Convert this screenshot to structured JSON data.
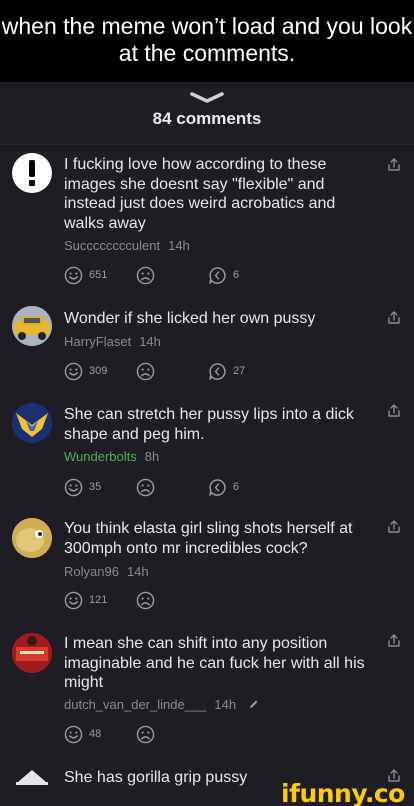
{
  "caption": "when the meme won’t load and you look at the comments.",
  "header": {
    "count_label": "84 comments"
  },
  "comments": [
    {
      "text": "I fucking love how according to these images she doesnt say \"flexible\" and instead just does weird acrobatics and walks away",
      "user": "Succcccccculent",
      "time": "14h",
      "smiles": "651",
      "replies": "6"
    },
    {
      "text": "Wonder if she licked her own pussy",
      "user": "HarryFlaset",
      "time": "14h",
      "smiles": "309",
      "replies": "27"
    },
    {
      "text": "She can stretch her pussy lips into a dick shape and peg him.",
      "user": "Wunderbolts",
      "time": "8h",
      "smiles": "35",
      "replies": "6"
    },
    {
      "text": "You think elasta girl sling shots herself at 300mph onto mr incredibles cock?",
      "user": "Rolyan96",
      "time": "14h",
      "smiles": "121"
    },
    {
      "text": "I mean she can shift into any position imaginable and he can fuck her with all his might",
      "user": "dutch_van_der_linde___",
      "time": "14h",
      "smiles": "48"
    },
    {
      "text": "She has gorilla grip pussy"
    }
  ],
  "icons": {
    "share": "share-icon",
    "smile": "smile-icon",
    "unsmile": "unsmile-icon",
    "reply": "reply-icon",
    "grabber": "chevron-down-icon",
    "edit": "pencil-icon"
  },
  "colors": {
    "background": "#1d1d23",
    "caption_bg": "#000000",
    "username_highlight": "#4caf50",
    "watermark": "#ffcc00"
  },
  "watermark": "ifunny.co"
}
